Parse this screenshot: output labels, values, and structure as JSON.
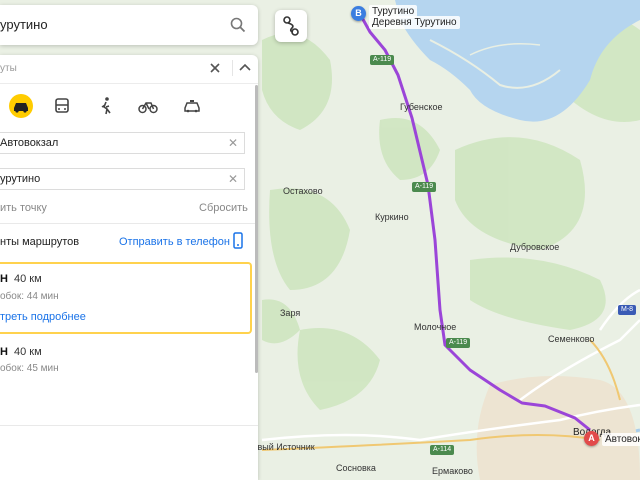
{
  "search": {
    "value": "урутино"
  },
  "panel": {
    "title": "уты",
    "from_value": "Автовокзал",
    "to_value": "урутино",
    "add_point": "ить точку",
    "reset": "Сбросить",
    "variants_label": "нты маршрутов",
    "send_to_phone": "Отправить в телефон",
    "routes": [
      {
        "time": "Н",
        "distance": "40 км",
        "jams": "обок: 44 мин",
        "more": "треть подробнее"
      },
      {
        "time": "Н",
        "distance": "40 км",
        "jams": "обок: 45 мин"
      }
    ]
  },
  "map": {
    "point_b": {
      "badge": "B",
      "label": "Турутино",
      "sublabel": "Деревня Турутино"
    },
    "point_a": {
      "badge": "A",
      "label": "Автовок"
    },
    "places": [
      "Губенское",
      "Остахово",
      "Куркино",
      "Дубровское",
      "Заря",
      "Молочное",
      "Семенково",
      "Вологда",
      "Новый Источник",
      "Сосновка",
      "Ермаково"
    ],
    "roads": [
      "А-119",
      "А-119",
      "А-119",
      "М-8",
      "А-114"
    ],
    "route_color": "#9b45d8"
  }
}
